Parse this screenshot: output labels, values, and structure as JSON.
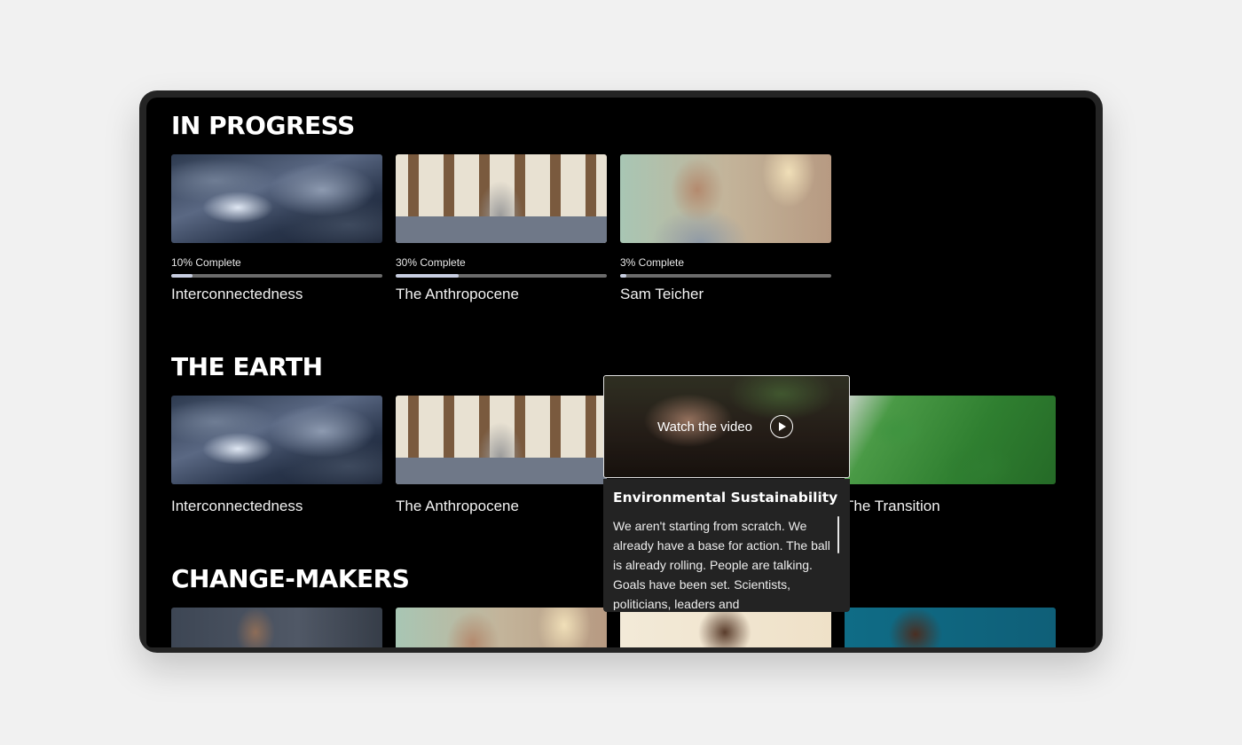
{
  "sections": {
    "in_progress": {
      "heading": "IN PROGRESS",
      "items": [
        {
          "title": "Interconnectedness",
          "progress_label": "10% Complete",
          "progress": 0.1,
          "thumbnail": "storm-clouds"
        },
        {
          "title": "The Anthropocene",
          "progress_label": "30% Complete",
          "progress": 0.3,
          "thumbnail": "woman-street"
        },
        {
          "title": "Sam Teicher",
          "progress_label": "3% Complete",
          "progress": 0.03,
          "thumbnail": "man-speaking"
        }
      ]
    },
    "the_earth": {
      "heading": "THE EARTH",
      "items": [
        {
          "title": "Interconnectedness",
          "thumbnail": "storm-clouds"
        },
        {
          "title": "The Anthropocene",
          "thumbnail": "woman-street"
        },
        {
          "title": "The Transition",
          "thumbnail": "forest-bridge"
        }
      ],
      "hover_card": {
        "title": "Environmental Sustainability",
        "cta": "Watch the video",
        "thumbnail": "hands-planting-soil",
        "description": "We aren't starting from scratch. We already have a base for action. The ball is already rolling. People are talking. Goals have been set. Scientists, politicians, leaders and"
      }
    },
    "change_makers": {
      "heading": "CHANGE-MAKERS",
      "items": [
        {
          "thumbnail": "man-lab"
        },
        {
          "thumbnail": "man-speaking"
        },
        {
          "thumbnail": "woman-light"
        },
        {
          "thumbnail": "person-teal"
        }
      ]
    }
  },
  "colors": {
    "page_background": "#f1f1f1",
    "screen_background": "#000000",
    "progress_fill": "#c7cde0",
    "progress_track": "#6b6b6b",
    "card_background": "#232323"
  },
  "icons": {
    "play": "play-icon"
  }
}
